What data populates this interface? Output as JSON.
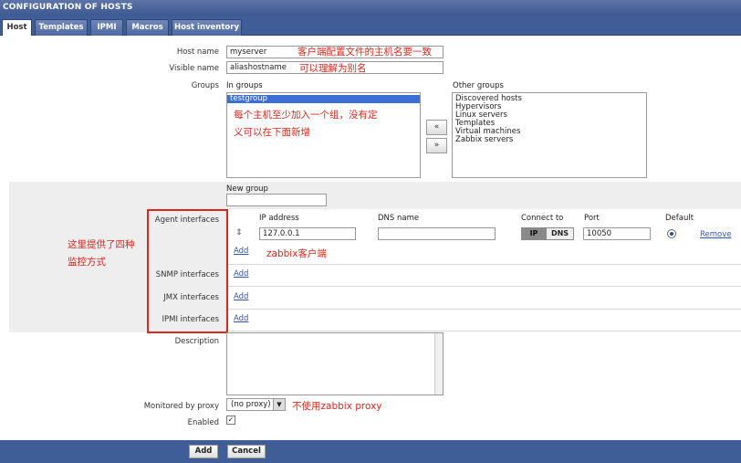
{
  "window_title": "CONFIGURATION OF HOSTS",
  "tabs": [
    {
      "label": "Host"
    },
    {
      "label": "Templates"
    },
    {
      "label": "IPMI"
    },
    {
      "label": "Macros"
    },
    {
      "label": "Host inventory"
    }
  ],
  "form": {
    "host_name": {
      "label": "Host name",
      "value": "myserver"
    },
    "visible_name": {
      "label": "Visible name",
      "value": "aliashostname"
    },
    "groups": {
      "label": "Groups",
      "in_groups_label": "In groups",
      "in_groups": [
        "testgroup"
      ],
      "other_groups_label": "Other groups",
      "other_groups": [
        "Discovered hosts",
        "Hypervisors",
        "Linux servers",
        "Templates",
        "Virtual machines",
        "Zabbix servers"
      ],
      "add_btn": "«",
      "remove_btn": "»"
    },
    "new_group": {
      "label": "New group",
      "value": ""
    },
    "interfaces": {
      "agent_label": "Agent interfaces",
      "col_ip": "IP address",
      "col_dns": "DNS name",
      "col_connect": "Connect to",
      "col_port": "Port",
      "col_default": "Default",
      "drag_handle": "⇕",
      "ip_value": "127.0.0.1",
      "dns_value": "",
      "connect_ip": "IP",
      "connect_dns": "DNS",
      "port_value": "10050",
      "remove_link": "Remove",
      "add_link": "Add",
      "snmp_label": "SNMP interfaces",
      "jmx_label": "JMX interfaces",
      "ipmi_label": "IPMI interfaces"
    },
    "description": {
      "label": "Description",
      "value": ""
    },
    "proxy": {
      "label": "Monitored by proxy",
      "value": "(no proxy)"
    },
    "enabled": {
      "label": "Enabled",
      "checked": true,
      "check_mark": "✓"
    }
  },
  "footer": {
    "add_button": "Add",
    "cancel_button": "Cancel"
  },
  "annotations": {
    "host_name_note": "客户端配置文件的主机名要一致",
    "visible_name_note": "可以理解为别名",
    "groups_note_line1": "每个主机至少加入一个组，没有定",
    "groups_note_line2": "义可以在下面新增",
    "interfaces_note_line1": "这里提供了四种",
    "interfaces_note_line2": "监控方式",
    "agent_note": "zabbix客户端",
    "proxy_note": "不使用zabbix proxy"
  },
  "colors": {
    "header_blue": "#3f5d96",
    "annotation_red": "#e0251b",
    "selection_blue": "#3b6fd6"
  }
}
